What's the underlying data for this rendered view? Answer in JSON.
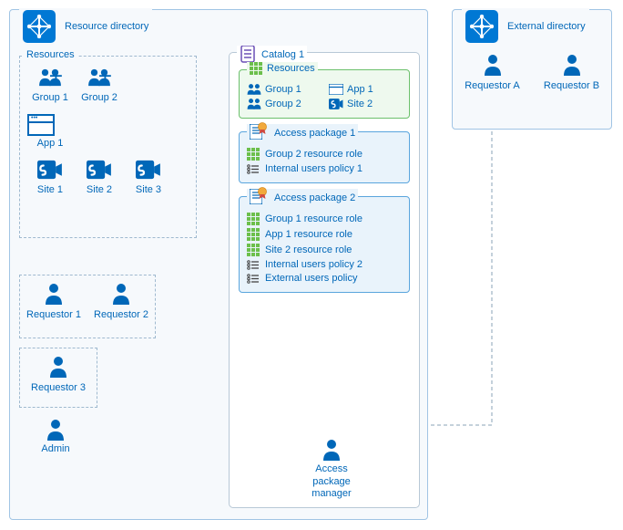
{
  "resource_directory": {
    "title": "Resource directory",
    "resources_label": "Resources",
    "resources": {
      "group1": "Group 1",
      "group2": "Group 2",
      "app1": "App 1",
      "site1": "Site 1",
      "site2": "Site 2",
      "site3": "Site 3"
    },
    "requestors": {
      "r1": "Requestor 1",
      "r2": "Requestor 2",
      "r3": "Requestor 3"
    },
    "admin": "Admin"
  },
  "catalog": {
    "title": "Catalog 1",
    "resources_label": "Resources",
    "resources": {
      "group1": "Group 1",
      "group2": "Group 2",
      "app1": "App 1",
      "site2": "Site 2"
    },
    "ap1": {
      "title": "Access package 1",
      "role1": "Group 2 resource role",
      "policy1": "Internal users policy 1"
    },
    "ap2": {
      "title": "Access package 2",
      "role1": "Group 1 resource role",
      "role2": "App 1 resource role",
      "role3": "Site 2 resource role",
      "policy_internal": "Internal users policy 2",
      "policy_external": "External users policy"
    },
    "manager": "Access package manager"
  },
  "external_directory": {
    "title": "External directory",
    "requestors": {
      "a": "Requestor A",
      "b": "Requestor B"
    }
  }
}
